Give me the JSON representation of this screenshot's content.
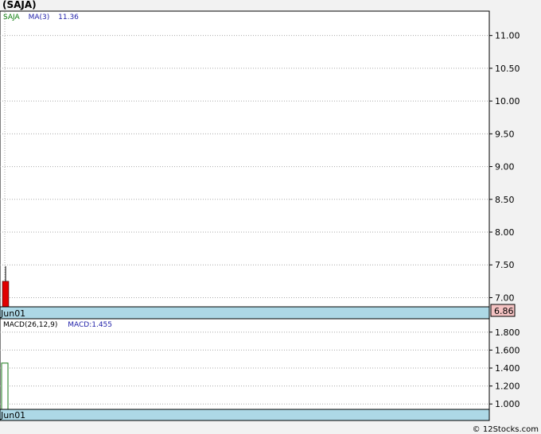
{
  "chart_title": "(SAJA)",
  "credit": "© 12Stocks.com",
  "colors": {
    "panel_bg": "#ffffff",
    "date_bar": "#add8e6",
    "grid": "#a9a9a9",
    "candle_down": "#e00000",
    "price_tag_bg": "#f4c2c2",
    "ticker_label": "#0a7d0a",
    "ma_label": "#1e1ea8",
    "macd_bar": "#1a7a1a"
  },
  "chart_data": [
    {
      "type": "candlestick",
      "legend": {
        "ticker": "SAJA",
        "ma_label": "MA(3)",
        "ma_value": "11.36"
      },
      "x_label": "Jun01",
      "yticks": [
        7.0,
        7.5,
        8.0,
        8.5,
        9.0,
        9.5,
        10.0,
        10.5,
        11.0
      ],
      "ytick_labels": [
        "7.00",
        "7.50",
        "8.00",
        "8.50",
        "9.00",
        "9.50",
        "10.00",
        "10.50",
        "11.00"
      ],
      "ylim": [
        6.86,
        11.36
      ],
      "candles": [
        {
          "date": "Jun01",
          "open": 7.25,
          "high": 7.48,
          "low": 6.86,
          "close": 6.86,
          "direction": "down"
        }
      ],
      "last_price": "6.86",
      "grid": true
    },
    {
      "type": "bar",
      "legend": {
        "label": "MACD(26,12,9)",
        "value_label": "MACD:1.455"
      },
      "x_label": "Jun01",
      "yticks": [
        1.0,
        1.2,
        1.4,
        1.6,
        1.8
      ],
      "ytick_labels": [
        "1.000",
        "1.200",
        "1.400",
        "1.600",
        "1.800"
      ],
      "ylim": [
        0.94,
        1.94
      ],
      "values": [
        1.455
      ],
      "grid": true
    }
  ]
}
